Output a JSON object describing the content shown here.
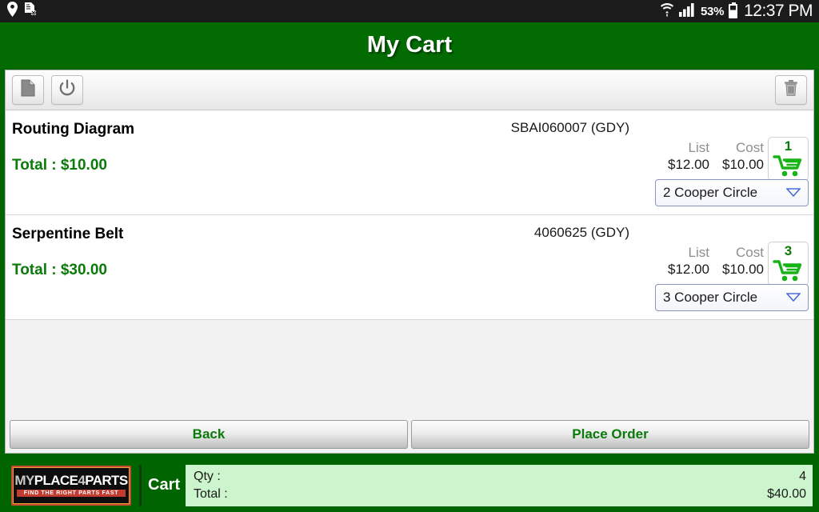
{
  "status_bar": {
    "icons_left": [
      "location-pin-icon",
      "document-x-icon"
    ],
    "icons_right": [
      "wifi-icon",
      "signal-bars-icon",
      "battery-icon"
    ],
    "battery": "53%",
    "clock": "12:37 PM"
  },
  "header": {
    "title": "My Cart",
    "background": "#026b02"
  },
  "toolbar": {
    "buttons": [
      {
        "name": "document-icon",
        "glyph": "page"
      },
      {
        "name": "power-icon",
        "glyph": "power"
      }
    ],
    "delete_button": {
      "name": "trash-icon",
      "glyph": "trash"
    }
  },
  "cart": {
    "price_labels": {
      "list": "List",
      "cost": "Cost"
    },
    "items": [
      {
        "name": "Routing Diagram",
        "total_label": "Total : $10.00",
        "part_number": "SBAI060007 (GDY)",
        "list_price": "$12.00",
        "cost_price": "$10.00",
        "qty": "1",
        "location": "2 Cooper Circle"
      },
      {
        "name": "Serpentine Belt",
        "total_label": "Total : $30.00",
        "part_number": "4060625 (GDY)",
        "list_price": "$12.00",
        "cost_price": "$10.00",
        "qty": "3",
        "location": "3 Cooper Circle"
      }
    ]
  },
  "actions": {
    "back_label": "Back",
    "place_order_label": "Place Order",
    "accent": "#0a7a0a"
  },
  "footer": {
    "logo": {
      "line1_a": "MY",
      "line1_b": "PLACE",
      "line1_c": "4",
      "line1_d": "PARTS",
      "tagline": "FIND THE RIGHT PARTS FAST"
    },
    "cart_label": "Cart",
    "qty_label": "Qty :",
    "qty_value": "4",
    "total_label": "Total :",
    "total_value": "$40.00"
  }
}
